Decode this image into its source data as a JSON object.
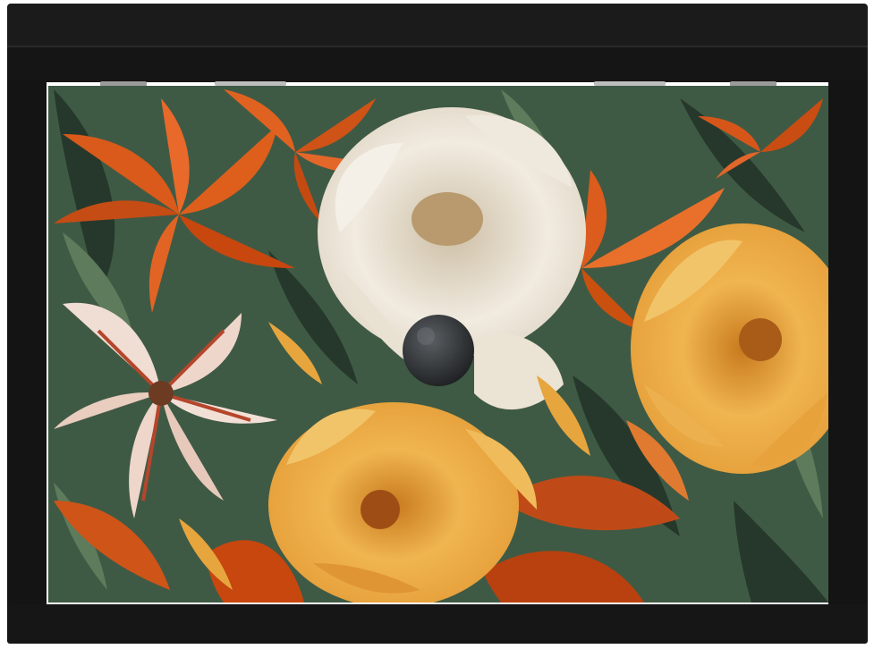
{
  "product": {
    "type": "bread box cabinet",
    "colors": {
      "cabinet_black": "#141414",
      "cabinet_edge": "#262626",
      "background_green": "#3f5a44",
      "dark_leaf": "#26382b",
      "orange_lily": "#e0621b",
      "orange_lily_dark": "#b9410f",
      "cream_flower": "#ece5d8",
      "yellow_flower": "#e9a83e",
      "yellow_flower_light": "#f2c46a",
      "pink_lily": "#eed7cc",
      "red_stripe": "#b5452b",
      "knob": "#2d3033"
    },
    "icons": [
      "knob-icon",
      "hinge-icon"
    ]
  }
}
